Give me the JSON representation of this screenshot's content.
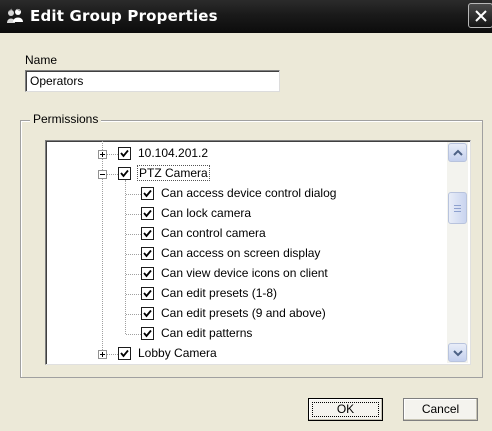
{
  "window": {
    "title": "Edit Group Properties",
    "icon": "group-icon",
    "close_icon": "close-icon"
  },
  "name_field": {
    "label": "Name",
    "value": "Operators"
  },
  "permissions": {
    "label": "Permissions",
    "tree": [
      {
        "label": "10.104.201.2",
        "level": 0,
        "expander": "plus",
        "checked": true
      },
      {
        "label": "PTZ Camera",
        "level": 0,
        "expander": "minus",
        "checked": true,
        "selected": true
      },
      {
        "label": "Can access device control dialog",
        "level": 1,
        "checked": true
      },
      {
        "label": "Can lock camera",
        "level": 1,
        "checked": true
      },
      {
        "label": "Can control camera",
        "level": 1,
        "checked": true
      },
      {
        "label": "Can access on screen display",
        "level": 1,
        "checked": true
      },
      {
        "label": "Can view device icons on client",
        "level": 1,
        "checked": true
      },
      {
        "label": "Can edit presets (1-8)",
        "level": 1,
        "checked": true
      },
      {
        "label": "Can edit presets (9 and above)",
        "level": 1,
        "checked": true
      },
      {
        "label": "Can edit patterns",
        "level": 1,
        "checked": true
      },
      {
        "label": "Lobby Camera",
        "level": 0,
        "expander": "plus",
        "checked": true
      }
    ]
  },
  "buttons": {
    "ok": "OK",
    "cancel": "Cancel"
  },
  "colors": {
    "titlebar": "#111111",
    "dialog_bg": "#ece9d8",
    "scrollbar_accent": "#c4d0ee"
  }
}
